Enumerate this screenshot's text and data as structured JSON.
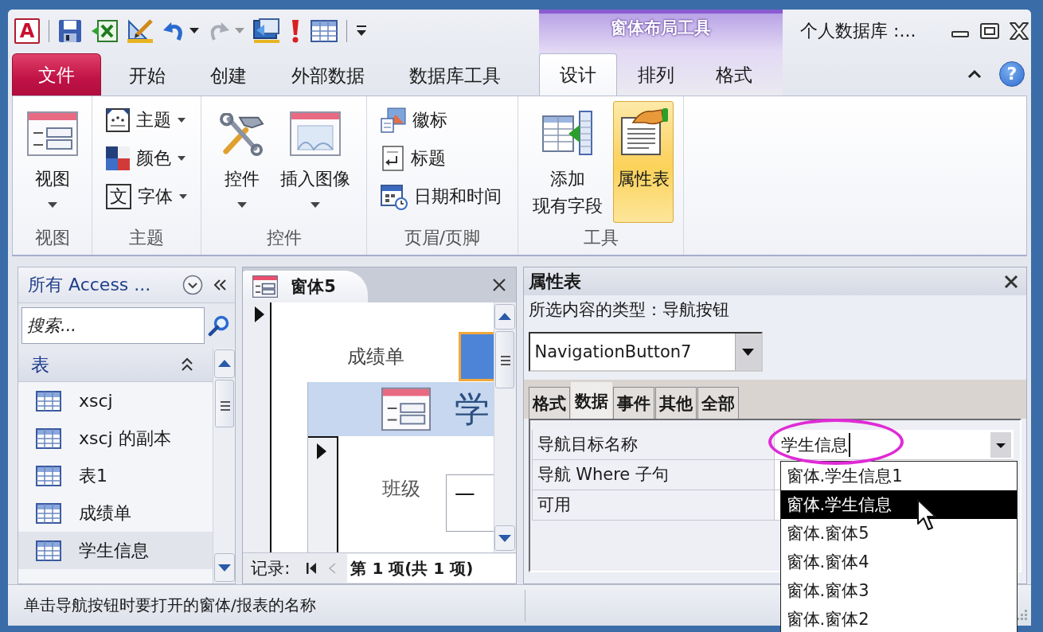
{
  "title_bar": {
    "app_logo": "A",
    "context_group": "窗体布局工具",
    "title": "个人数据库 :..."
  },
  "ribbon": {
    "tabs": [
      {
        "label": "文件",
        "kind": "file",
        "selected": false
      },
      {
        "label": "开始",
        "kind": "tab",
        "selected": false
      },
      {
        "label": "创建",
        "kind": "tab",
        "selected": false
      },
      {
        "label": "外部数据",
        "kind": "tab",
        "selected": false
      },
      {
        "label": "数据库工具",
        "kind": "tab",
        "selected": false
      }
    ],
    "context_tabs": [
      {
        "label": "设计",
        "selected": true
      },
      {
        "label": "排列",
        "selected": false
      },
      {
        "label": "格式",
        "selected": false
      }
    ],
    "help": "?",
    "groups": [
      {
        "label": "视图",
        "commands": [
          {
            "lines": [
              "视图"
            ],
            "kind": "large",
            "dropdown": true,
            "on": false
          }
        ]
      },
      {
        "label": "主题",
        "commands": [
          {
            "label": "主题",
            "kind": "small",
            "dropdown": true,
            "on": false
          },
          {
            "label": "颜色",
            "kind": "small",
            "dropdown": true,
            "on": false
          },
          {
            "label": "字体",
            "kind": "small",
            "dropdown": true,
            "on": false,
            "glyph": "文"
          }
        ]
      },
      {
        "label": "控件",
        "commands": [
          {
            "lines": [
              "控件"
            ],
            "kind": "large",
            "dropdown": true,
            "on": false
          },
          {
            "lines": [
              "插入图像"
            ],
            "kind": "large",
            "dropdown": true,
            "on": false
          }
        ]
      },
      {
        "label": "页眉/页脚",
        "commands": [
          {
            "label": "徽标",
            "kind": "small",
            "dropdown": false,
            "on": false
          },
          {
            "label": "标题",
            "kind": "small",
            "dropdown": false,
            "on": false
          },
          {
            "label": "日期和时间",
            "kind": "small",
            "dropdown": false,
            "on": false
          }
        ]
      },
      {
        "label": "工具",
        "commands": [
          {
            "lines": [
              "添加",
              "现有字段"
            ],
            "kind": "large",
            "dropdown": false,
            "on": false
          },
          {
            "lines": [
              "属性表"
            ],
            "kind": "large",
            "dropdown": false,
            "on": true
          }
        ]
      }
    ]
  },
  "nav_pane": {
    "title": "所有 Access ...",
    "search": {
      "placeholder": "搜索..."
    },
    "group": {
      "label": "表",
      "expanded": true
    },
    "items": [
      {
        "label": "xscj",
        "selected": false
      },
      {
        "label": "xscj 的副本",
        "selected": false
      },
      {
        "label": "表1",
        "selected": false
      },
      {
        "label": "成绩单",
        "selected": false
      },
      {
        "label": "学生信息",
        "selected": true
      }
    ]
  },
  "document": {
    "tab": "窗体5",
    "form": {
      "title_label": "成绩单",
      "subform": {
        "header": "学",
        "field_label": "班级",
        "field_value": "一"
      }
    },
    "record_nav": {
      "label": "记录:",
      "position": "第 1 项(共 1 项)"
    }
  },
  "property_sheet": {
    "title": "属性表",
    "selection_type": "所选内容的类型：导航按钮",
    "object": "NavigationButton7",
    "tabs": [
      {
        "label": "格式",
        "selected": false
      },
      {
        "label": "数据",
        "selected": true
      },
      {
        "label": "事件",
        "selected": false
      },
      {
        "label": "其他",
        "selected": false
      },
      {
        "label": "全部",
        "selected": false
      }
    ],
    "properties": [
      {
        "name": "导航目标名称",
        "value": "学生信息",
        "active": true,
        "circled": true
      },
      {
        "name": "导航 Where 子句",
        "active": false,
        "circled": false
      },
      {
        "name": "可用",
        "active": false,
        "circled": false
      }
    ],
    "dropdown": [
      {
        "label": "窗体.学生信息1",
        "selected": false
      },
      {
        "label": "窗体.学生信息",
        "selected": true
      },
      {
        "label": "窗体.窗体5",
        "selected": false
      },
      {
        "label": "窗体.窗体4",
        "selected": false
      },
      {
        "label": "窗体.窗体3",
        "selected": false
      },
      {
        "label": "窗体.窗体2",
        "selected": false
      }
    ]
  },
  "status_bar": {
    "text": "单击导航按钮时要打开的窗体/报表的名称"
  }
}
